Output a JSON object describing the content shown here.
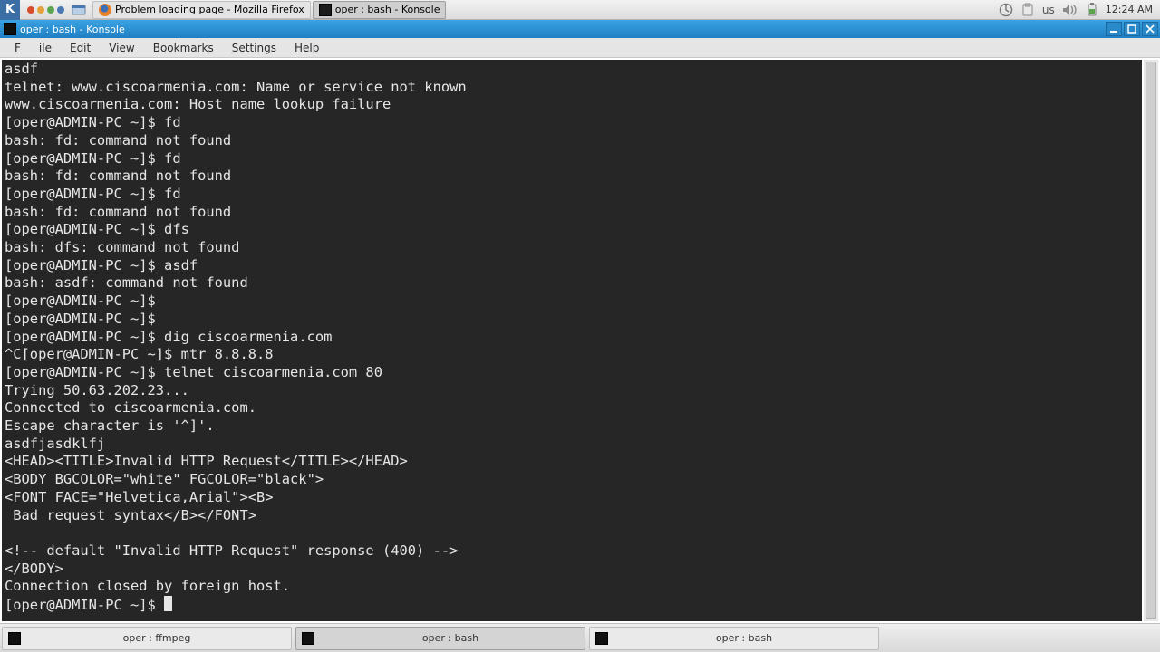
{
  "panel": {
    "kmenu_label": "K",
    "task_firefox": "Problem loading page - Mozilla Firefox",
    "task_konsole": "oper : bash - Konsole",
    "keyboard_layout": "us",
    "clock": "12:24 AM"
  },
  "window": {
    "title": "oper : bash - Konsole",
    "menus": {
      "file": "File",
      "edit": "Edit",
      "view": "View",
      "bookmarks": "Bookmarks",
      "settings": "Settings",
      "help": "Help"
    }
  },
  "terminal": {
    "content": "asdf\ntelnet: www.ciscoarmenia.com: Name or service not known\nwww.ciscoarmenia.com: Host name lookup failure\n[oper@ADMIN-PC ~]$ fd\nbash: fd: command not found\n[oper@ADMIN-PC ~]$ fd\nbash: fd: command not found\n[oper@ADMIN-PC ~]$ fd\nbash: fd: command not found\n[oper@ADMIN-PC ~]$ dfs\nbash: dfs: command not found\n[oper@ADMIN-PC ~]$ asdf\nbash: asdf: command not found\n[oper@ADMIN-PC ~]$ \n[oper@ADMIN-PC ~]$ \n[oper@ADMIN-PC ~]$ dig ciscoarmenia.com\n^C[oper@ADMIN-PC ~]$ mtr 8.8.8.8\n[oper@ADMIN-PC ~]$ telnet ciscoarmenia.com 80\nTrying 50.63.202.23...\nConnected to ciscoarmenia.com.\nEscape character is '^]'.\nasdfjasdklfj\n<HEAD><TITLE>Invalid HTTP Request</TITLE></HEAD>\n<BODY BGCOLOR=\"white\" FGCOLOR=\"black\">\n<FONT FACE=\"Helvetica,Arial\"><B>\n Bad request syntax</B></FONT>\n\n<!-- default \"Invalid HTTP Request\" response (400) -->\n</BODY>\nConnection closed by foreign host.\n[oper@ADMIN-PC ~]$ "
  },
  "bottom": {
    "task1": "oper : ffmpeg",
    "task2": "oper : bash",
    "task3": "oper : bash"
  }
}
